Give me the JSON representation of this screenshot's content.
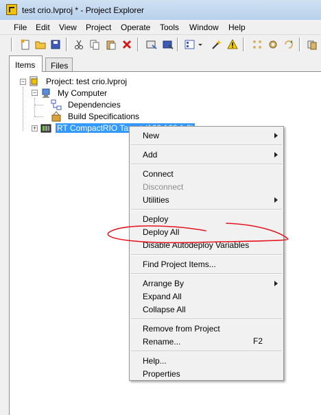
{
  "window": {
    "title": "test crio.lvproj * - Project Explorer"
  },
  "menubar": [
    "File",
    "Edit",
    "View",
    "Project",
    "Operate",
    "Tools",
    "Window",
    "Help"
  ],
  "tabs": {
    "items": "Items",
    "files": "Files"
  },
  "tree": {
    "project": "Project: test crio.lvproj",
    "my_computer": "My Computer",
    "dependencies": "Dependencies",
    "build_specs": "Build Specifications",
    "rt_target": "RT CompactRIO Target (192.168.1.2)"
  },
  "context_menu": {
    "new": "New",
    "add": "Add",
    "connect": "Connect",
    "disconnect": "Disconnect",
    "utilities": "Utilities",
    "deploy": "Deploy",
    "deploy_all": "Deploy All",
    "disable_autodeploy": "Disable Autodeploy Variables",
    "find_items": "Find Project Items...",
    "arrange_by": "Arrange By",
    "expand_all": "Expand All",
    "collapse_all": "Collapse All",
    "remove": "Remove from Project",
    "rename": "Rename...",
    "rename_shortcut": "F2",
    "help": "Help...",
    "properties": "Properties"
  },
  "colors": {
    "selection": "#3399ff",
    "annotation": "#e8121b"
  }
}
